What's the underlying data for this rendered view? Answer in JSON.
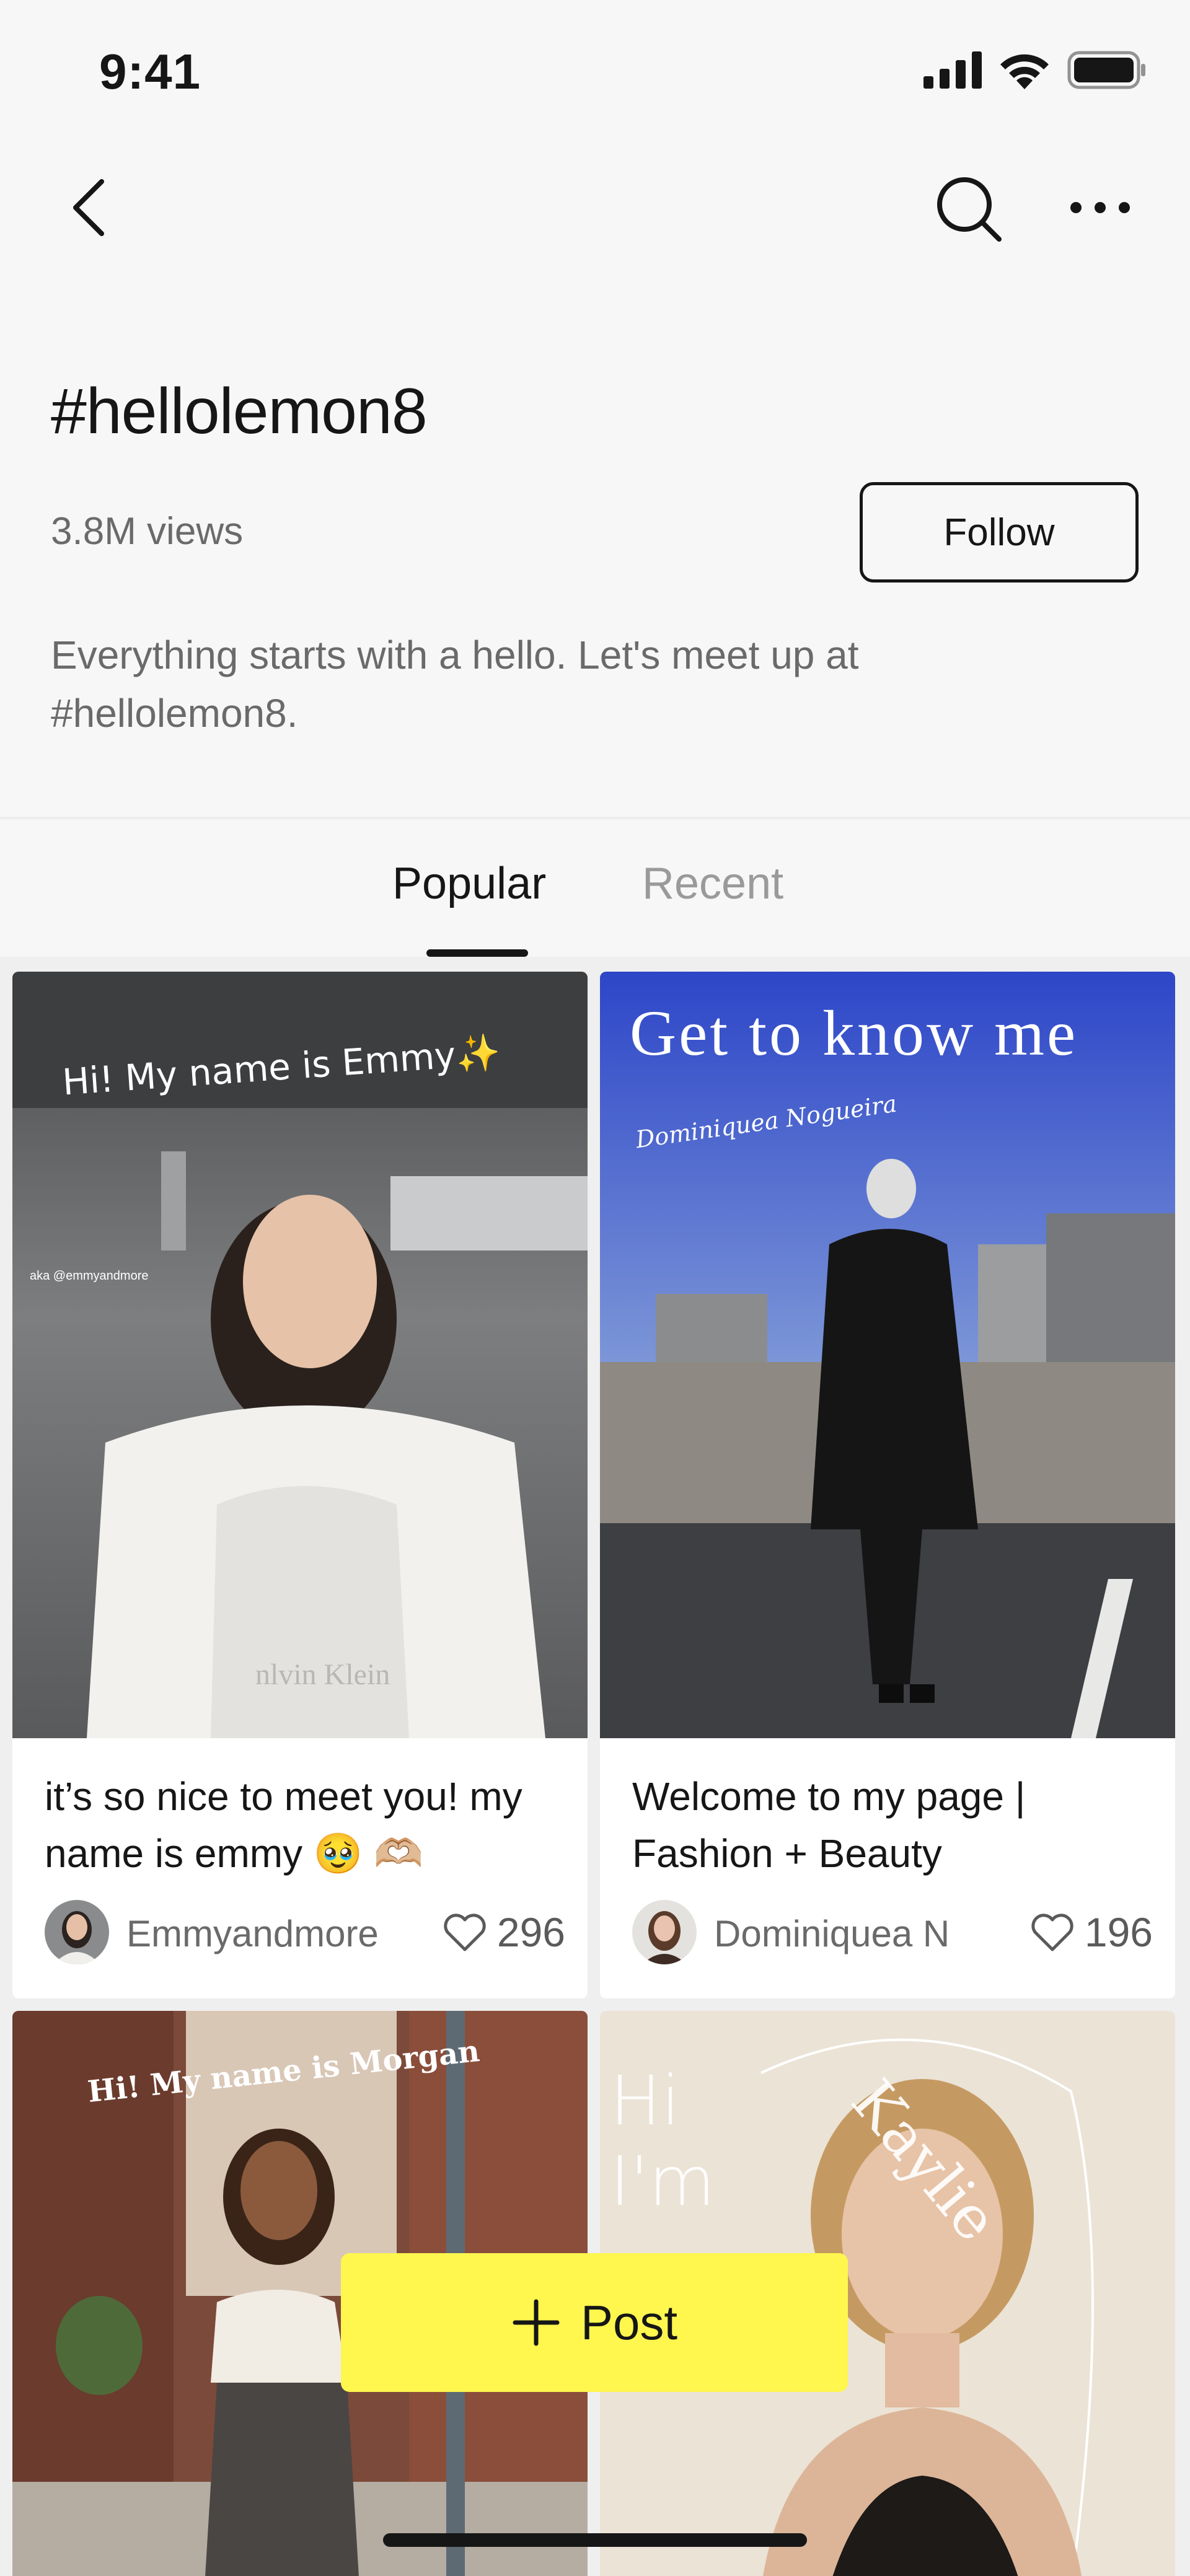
{
  "status_bar": {
    "time": "9:41"
  },
  "nav": {
    "back_icon": "chevron-left-icon",
    "search_icon": "search-icon",
    "more_icon": "more-horizontal-icon"
  },
  "header": {
    "hashtag": "#hellolemon8",
    "views": "3.8M views",
    "follow_label": "Follow",
    "description": "Everything starts with a hello. Let's meet up at #hellolemon8."
  },
  "tabs": [
    {
      "label": "Popular",
      "active": true
    },
    {
      "label": "Recent",
      "active": false
    }
  ],
  "posts": [
    {
      "title": "it’s so nice to meet you! my name is emmy 🥹 🫶🏼",
      "author": "Emmyandmore",
      "likes": "296",
      "overlay": "Hi! My name is Emmy✨",
      "overlay_sub": "aka @emmyandmore"
    },
    {
      "title": "Welcome to my page | Fashion + Beauty",
      "author": "Dominiquea N",
      "likes": "196",
      "overlay": "Get to know me",
      "overlay_sub": "Dominiquea Nogueira"
    },
    {
      "overlay": "Hi! My name is Morgan"
    },
    {
      "overlay": "Hi I'm",
      "overlay_name": "Kaylie"
    }
  ],
  "post_button": {
    "label": "Post",
    "icon": "plus-icon",
    "color": "#fff64e"
  }
}
